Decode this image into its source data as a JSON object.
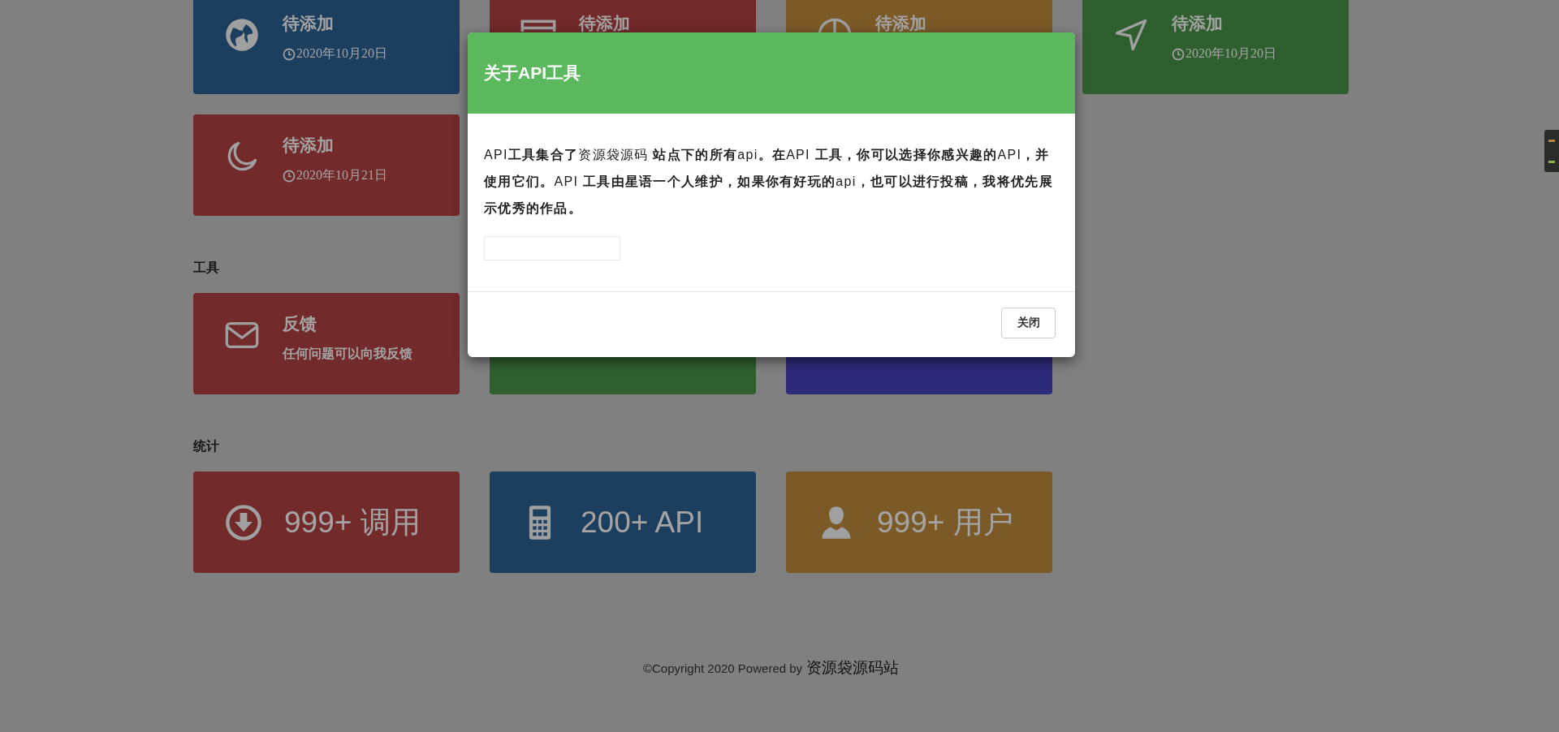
{
  "sections": [
    {
      "cards": [
        {
          "kind": "globe",
          "title": "待添加",
          "date": "2020年10月20日",
          "color": "#1c3e5f"
        },
        {
          "kind": "window",
          "title": "待添加",
          "color": "#722a2a"
        },
        {
          "kind": "compass",
          "title": "待添加",
          "color": "#7b5a28"
        },
        {
          "kind": "send",
          "title": "待添加",
          "date": "2020年10月20日",
          "color": "#2f5f2f"
        },
        {
          "kind": "moon",
          "title": "待添加",
          "date": "2020年10月21日",
          "color": "#722a2a"
        }
      ]
    },
    {
      "heading": "工具",
      "cards": [
        {
          "kind": "mail",
          "title": "反馈",
          "description": "任何问题可以向我反馈",
          "color": "#722a2a"
        },
        {
          "kind": "blank",
          "color": "#2f5f2f"
        },
        {
          "kind": "blank",
          "color": "#2e2a7a"
        }
      ]
    },
    {
      "heading": "统计",
      "stats": [
        {
          "kind": "download",
          "text": "999+ 调用",
          "color": "#722a2a"
        },
        {
          "kind": "calculator",
          "text": "200+ API",
          "color": "#1c3e5f"
        },
        {
          "kind": "user",
          "text": "999+ 用户",
          "color": "#7b5a28"
        }
      ]
    }
  ],
  "footer": {
    "text": "©Copyright 2020 Powered by",
    "brand": "资源袋源码站"
  },
  "modal": {
    "title": "关于API工具",
    "body": "API**工具集合了**资源袋源码 **站点下的所有**api**。在**API **工具，你可以选择你感兴趣的**API**，并使用它们。**API **工具由星语一个人维护，如果你有好玩的**api**，也可以进行投稿，我将优先展示优秀的作品。**",
    "close": "关闭"
  }
}
